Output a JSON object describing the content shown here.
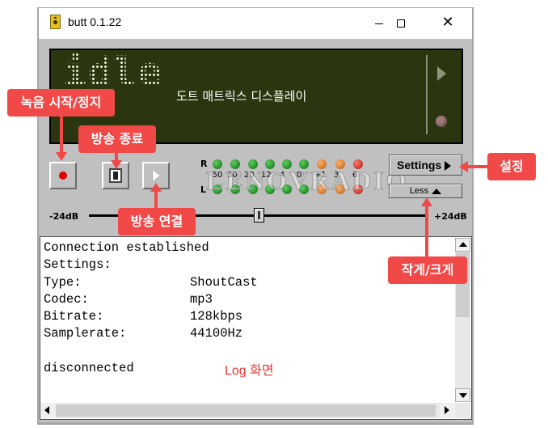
{
  "window": {
    "title": "butt 0.1.22",
    "close_symbol": "✕"
  },
  "display": {
    "status_text": "idle",
    "annotation": "도트 매트릭스 디스플레이"
  },
  "vu_meter": {
    "right_label": "R",
    "left_label": "L",
    "scale": [
      "-50",
      "30",
      "20",
      "12",
      "4",
      "0",
      "+1",
      "3",
      "6"
    ]
  },
  "buttons": {
    "settings_label": "Settings",
    "less_label": "Less"
  },
  "volume": {
    "min_label": "-24dB",
    "max_label": "+24dB",
    "level": 0.5
  },
  "watermark": "LENOVRADIO",
  "log": {
    "lines": [
      "Connection established",
      "Settings:",
      "Type:",
      "Codec:",
      "Bitrate:",
      "Samplerate:",
      "",
      "disconnected"
    ],
    "values": [
      "ShoutCast",
      "mp3",
      "128kbps",
      "44100Hz"
    ],
    "annotation": "Log 화면"
  },
  "callouts": {
    "record": "녹음 시작/정지",
    "stop": "방송 종료",
    "connect": "방송 연결",
    "settings": "설정",
    "size": "작게/크게"
  },
  "colors": {
    "accent": "#f14848",
    "display_bg": "#2b3610",
    "window_bg": "#c0c0c0"
  }
}
